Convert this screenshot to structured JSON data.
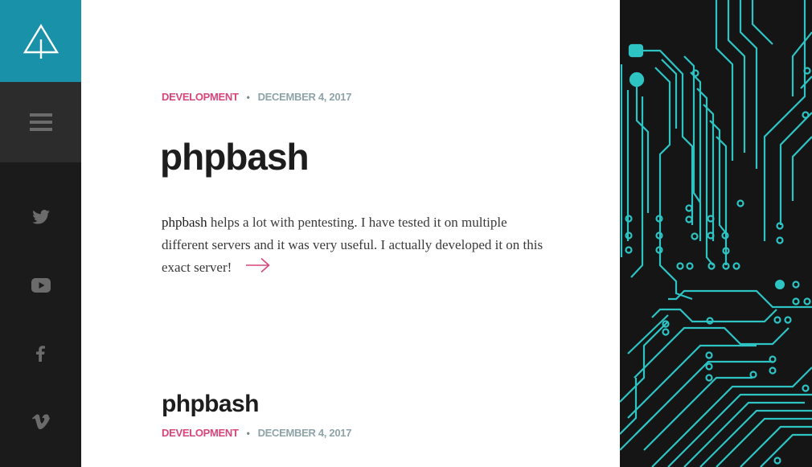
{
  "sidebar": {
    "logo_icon": "tree-logo-icon",
    "menu_icon": "hamburger-menu-icon",
    "social": [
      "twitter-icon",
      "youtube-icon",
      "facebook-icon",
      "vimeo-icon"
    ]
  },
  "posts": [
    {
      "category": "DEVELOPMENT",
      "separator": "•",
      "date": "DECEMBER 4, 2017",
      "title": "phpbash",
      "excerpt_strong": "phpbash",
      "excerpt_rest": " helps a lot with pentesting. I have tested it on multiple different servers and it was very useful. I actually developed it on this exact server!",
      "read_more_icon": "arrow-right-icon"
    },
    {
      "title": "phpbash",
      "category": "DEVELOPMENT",
      "separator": "•",
      "date": "DECEMBER 4, 2017"
    }
  ],
  "colors": {
    "accent": "#1891a9",
    "category": "#d6467a",
    "date": "#8ea3a8",
    "circuit": "#2ec4c4"
  }
}
